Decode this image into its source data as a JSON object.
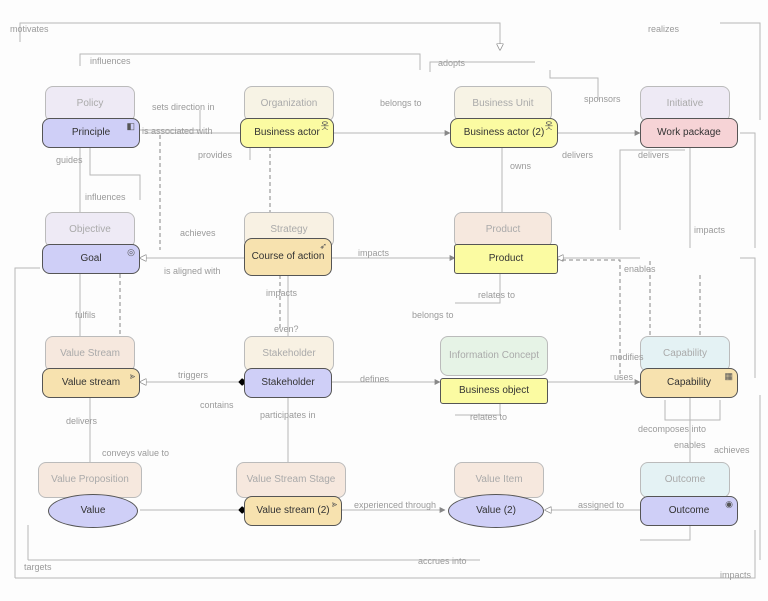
{
  "chart_data": {
    "type": "archimate-diagram",
    "title": "",
    "active_elements": [
      {
        "id": "principle",
        "label": "Principle",
        "type": "Principle",
        "color": "#CFCFF7"
      },
      {
        "id": "goal",
        "label": "Goal",
        "type": "Goal",
        "color": "#CFCFF7"
      },
      {
        "id": "business_actor",
        "label": "Business actor",
        "type": "BusinessActor",
        "color": "#FBFBA2"
      },
      {
        "id": "business_actor2",
        "label": "Business actor (2)",
        "type": "BusinessActor",
        "color": "#FBFBA2"
      },
      {
        "id": "work_package",
        "label": "Work package",
        "type": "WorkPackage",
        "color": "#F6D3D6"
      },
      {
        "id": "course_of_action",
        "label": "Course of action",
        "type": "CourseOfAction",
        "color": "#F7E2AF"
      },
      {
        "id": "product",
        "label": "Product",
        "type": "Product",
        "color": "#FBFBA2"
      },
      {
        "id": "value_stream",
        "label": "Value stream",
        "type": "ValueStream",
        "color": "#F7E2AF"
      },
      {
        "id": "stakeholder",
        "label": "Stakeholder",
        "type": "Stakeholder",
        "color": "#CFCFF7"
      },
      {
        "id": "business_object",
        "label": "Business object",
        "type": "BusinessObject",
        "color": "#FBFBA2"
      },
      {
        "id": "capability",
        "label": "Capability",
        "type": "Capability",
        "color": "#F7E2AF"
      },
      {
        "id": "value",
        "label": "Value",
        "type": "Value",
        "color": "#CFCFF7"
      },
      {
        "id": "value_stream2",
        "label": "Value stream (2)",
        "type": "ValueStream",
        "color": "#F7E2AF"
      },
      {
        "id": "value2",
        "label": "Value (2)",
        "type": "Value",
        "color": "#CFCFF7"
      },
      {
        "id": "outcome",
        "label": "Outcome",
        "type": "Outcome",
        "color": "#CFCFF7"
      }
    ],
    "ghost_elements": [
      {
        "id": "policy",
        "label": "Policy"
      },
      {
        "id": "organization",
        "label": "Organization"
      },
      {
        "id": "business_unit",
        "label": "Business Unit"
      },
      {
        "id": "initiative",
        "label": "Initiative"
      },
      {
        "id": "objective",
        "label": "Objective"
      },
      {
        "id": "strategy",
        "label": "Strategy"
      },
      {
        "id": "product_ghost",
        "label": "Product"
      },
      {
        "id": "value_stream_ghost",
        "label": "Value Stream"
      },
      {
        "id": "stakeholder_ghost",
        "label": "Stakeholder"
      },
      {
        "id": "information_concept",
        "label": "Information Concept"
      },
      {
        "id": "capability_ghost",
        "label": "Capability"
      },
      {
        "id": "value_proposition",
        "label": "Value Proposition"
      },
      {
        "id": "value_stream_stage",
        "label": "Value Stream Stage"
      },
      {
        "id": "value_item",
        "label": "Value Item"
      },
      {
        "id": "outcome_ghost",
        "label": "Outcome"
      }
    ],
    "relationships": [
      {
        "label": "motivates"
      },
      {
        "label": "influences"
      },
      {
        "label": "realizes"
      },
      {
        "label": "adopts"
      },
      {
        "label": "sets direction in"
      },
      {
        "label": "is associated with"
      },
      {
        "label": "belongs to"
      },
      {
        "label": "sponsors"
      },
      {
        "label": "guides"
      },
      {
        "label": "provides"
      },
      {
        "label": "owns"
      },
      {
        "label": "delivers"
      },
      {
        "label": "influences"
      },
      {
        "label": "achieves"
      },
      {
        "label": "impacts"
      },
      {
        "label": "is aligned with"
      },
      {
        "label": "enables"
      },
      {
        "label": "relates to"
      },
      {
        "label": "impacts"
      },
      {
        "label": "even?"
      },
      {
        "label": "belongs to"
      },
      {
        "label": "fulfils"
      },
      {
        "label": "triggers"
      },
      {
        "label": "defines"
      },
      {
        "label": "modifies"
      },
      {
        "label": "uses"
      },
      {
        "label": "contains"
      },
      {
        "label": "participates in"
      },
      {
        "label": "relates to"
      },
      {
        "label": "delivers"
      },
      {
        "label": "decomposes into"
      },
      {
        "label": "enables"
      },
      {
        "label": "conveys value to"
      },
      {
        "label": "achieves"
      },
      {
        "label": "experienced through"
      },
      {
        "label": "assigned to"
      },
      {
        "label": "targets"
      },
      {
        "label": "accrues into"
      },
      {
        "label": "impacts"
      }
    ]
  },
  "nodes": {
    "principle": "Principle",
    "goal": "Goal",
    "business_actor": "Business actor",
    "business_actor2": "Business actor (2)",
    "work_package": "Work package",
    "course_of_action": "Course of action",
    "product": "Product",
    "value_stream": "Value stream",
    "stakeholder": "Stakeholder",
    "business_object": "Business object",
    "capability": "Capability",
    "value": "Value",
    "value_stream2": "Value stream (2)",
    "value2": "Value (2)",
    "outcome": "Outcome"
  },
  "ghosts": {
    "policy": "Policy",
    "organization": "Organization",
    "business_unit": "Business Unit",
    "initiative": "Initiative",
    "objective": "Objective",
    "strategy": "Strategy",
    "product_ghost": "Product",
    "value_stream_ghost": "Value Stream",
    "stakeholder_ghost": "Stakeholder",
    "information_concept": "Information Concept",
    "capability_ghost": "Capability",
    "value_proposition": "Value Proposition",
    "value_stream_stage": "Value Stream Stage",
    "value_item": "Value Item",
    "outcome_ghost": "Outcome"
  },
  "labels": {
    "motivates": "motivates",
    "influences": "influences",
    "realizes": "realizes",
    "adopts": "adopts",
    "sets_direction_in": "sets direction in",
    "is_associated_with": "is associated with",
    "belongs_to": "belongs to",
    "sponsors": "sponsors",
    "guides": "guides",
    "provides": "provides",
    "owns": "owns",
    "delivers": "delivers",
    "achieves": "achieves",
    "impacts": "impacts",
    "is_aligned_with": "is aligned with",
    "enables": "enables",
    "relates_to": "relates to",
    "even": "even?",
    "fulfils": "fulfils",
    "triggers": "triggers",
    "defines": "defines",
    "modifies": "modifies",
    "uses": "uses",
    "contains": "contains",
    "participates_in": "participates in",
    "decomposes_into": "decomposes into",
    "conveys_value_to": "conveys value to",
    "experienced_through": "experienced through",
    "assigned_to": "assigned to",
    "targets": "targets",
    "accrues_into": "accrues into"
  },
  "colors": {
    "motivation": "#CFCFF7",
    "business": "#FBFBA2",
    "strategy": "#F7E2AF",
    "implementation": "#F6D3D6",
    "ghost_purple": "#E8E6F3",
    "ghost_orange": "#F6EEE0",
    "ghost_green": "#E6F3E6",
    "ghost_blue": "#E4F2F4"
  }
}
